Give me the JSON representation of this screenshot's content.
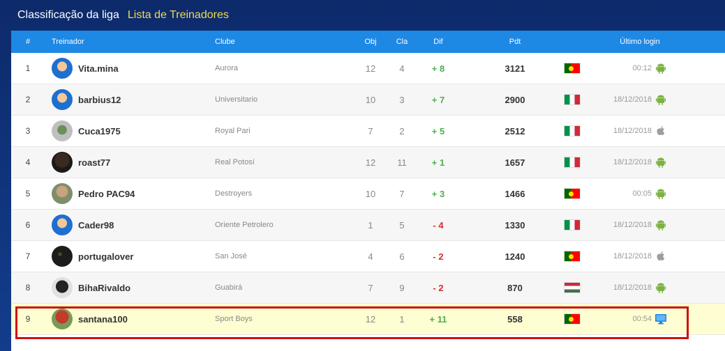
{
  "tabs": {
    "league": "Classificação da liga",
    "trainers": "Lista de Treinadores"
  },
  "header": {
    "rank": "#",
    "trainer": "Treinador",
    "club": "Clube",
    "obj": "Obj",
    "cla": "Cla",
    "dif": "Dif",
    "pdt": "Pdt",
    "last_login": "Último login"
  },
  "rows": [
    {
      "rank": "1",
      "name": "Vita.mina",
      "club": "Aurora",
      "obj": "12",
      "cla": "4",
      "dif": "+ 8",
      "pdt": "3121",
      "flag": "flag-portugal",
      "login": "00:12",
      "device": "android-icon"
    },
    {
      "rank": "2",
      "name": "barbius12",
      "club": "Universitario",
      "obj": "10",
      "cla": "3",
      "dif": "+ 7",
      "pdt": "2900",
      "flag": "flag-italy",
      "login": "18/12/2018",
      "device": "android-icon"
    },
    {
      "rank": "3",
      "name": "Cuca1975",
      "club": "Royal Pari",
      "obj": "7",
      "cla": "2",
      "dif": "+ 5",
      "pdt": "2512",
      "flag": "flag-italy",
      "login": "18/12/2018",
      "device": "apple-icon"
    },
    {
      "rank": "4",
      "name": "roast77",
      "club": "Real Potosí",
      "obj": "12",
      "cla": "11",
      "dif": "+ 1",
      "pdt": "1657",
      "flag": "flag-italy",
      "login": "18/12/2018",
      "device": "android-icon"
    },
    {
      "rank": "5",
      "name": "Pedro PAC94",
      "club": "Destroyers",
      "obj": "10",
      "cla": "7",
      "dif": "+ 3",
      "pdt": "1466",
      "flag": "flag-portugal",
      "login": "00:05",
      "device": "android-icon"
    },
    {
      "rank": "6",
      "name": "Cader98",
      "club": "Oriente Petrolero",
      "obj": "1",
      "cla": "5",
      "dif": "- 4",
      "pdt": "1330",
      "flag": "flag-italy",
      "login": "18/12/2018",
      "device": "android-icon"
    },
    {
      "rank": "7",
      "name": "portugalover",
      "club": "San José",
      "obj": "4",
      "cla": "6",
      "dif": "- 2",
      "pdt": "1240",
      "flag": "flag-portugal",
      "login": "18/12/2018",
      "device": "apple-icon"
    },
    {
      "rank": "8",
      "name": "BihaRivaldo",
      "club": "Guabirá",
      "obj": "7",
      "cla": "9",
      "dif": "- 2",
      "pdt": "870",
      "flag": "flag-hungary",
      "login": "18/12/2018",
      "device": "android-icon"
    },
    {
      "rank": "9",
      "name": "santana100",
      "club": "Sport Boys",
      "obj": "12",
      "cla": "1",
      "dif": "+ 11",
      "pdt": "558",
      "flag": "flag-portugal",
      "login": "00:54",
      "device": "desktop-icon"
    }
  ],
  "colors": {
    "header_bg": "#1e88e5",
    "positive": "#4caf50",
    "negative": "#d32f2f",
    "highlight_row": "#fefed2",
    "highlight_border": "#cc1111",
    "link_tab": "#f2d94e"
  }
}
